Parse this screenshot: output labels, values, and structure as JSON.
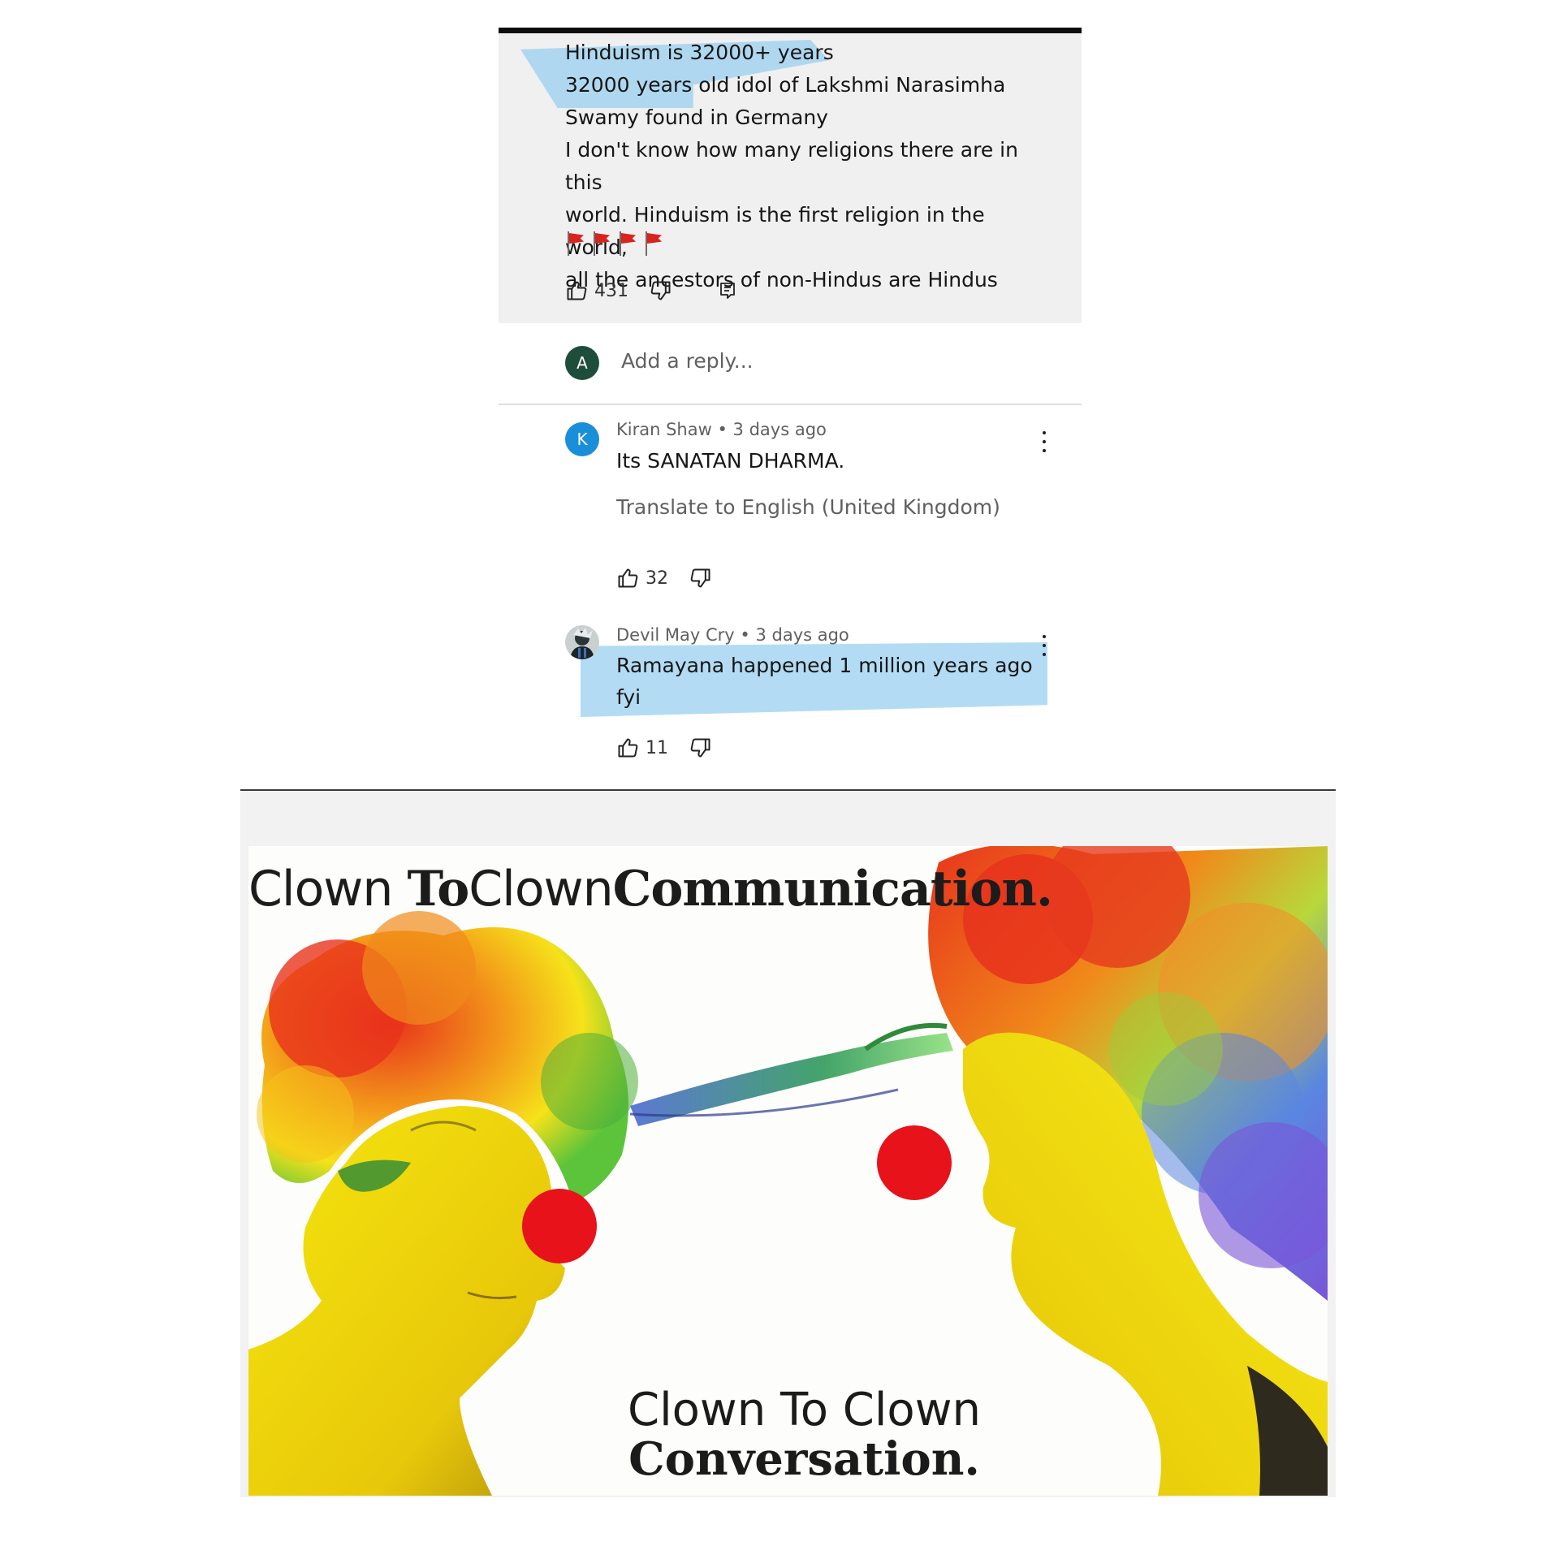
{
  "comment": {
    "lines": [
      "Hinduism is 32000+ years",
      "32000 years old idol of Lakshmi Narasimha",
      "Swamy found in Germany",
      "I don't know how many religions there are in this",
      "world. Hinduism is the first religion in the world,",
      "all the ancestors of non-Hindus are Hindus"
    ],
    "flag_count": 4,
    "likes": "431",
    "icons": [
      "flag-icon",
      "thumbs-up-icon",
      "thumbs-down-icon",
      "reply-icon"
    ]
  },
  "reply_box": {
    "avatar_letter": "A",
    "avatar_color": "#1e4d3c",
    "placeholder": "Add a reply..."
  },
  "replies": [
    {
      "avatar_letter": "K",
      "avatar_color": "#1a8fd9",
      "author": "Kiran Shaw",
      "age": "3 days ago",
      "separator": "•",
      "body": "Its SANATAN DHARMA.",
      "translate": "Translate to English (United Kingdom)",
      "likes": "32"
    },
    {
      "author": "Devil May Cry",
      "age": "3 days ago",
      "separator": "•",
      "body_lines": [
        "Ramayana happened 1 million years ago",
        "fyi"
      ],
      "likes": "11"
    }
  ],
  "highlight_color": "#96cef0",
  "meme": {
    "top_caption": {
      "part1": "Clown ",
      "part2": "To",
      "part3": "Clown",
      "part4": "Communication."
    },
    "bottom_caption": {
      "line1": "Clown To Clown",
      "line2": "Conversation."
    },
    "colors": {
      "skin": "#f3e20a",
      "nose": "#e8121a",
      "wig_red": "#e8331c",
      "wig_orange": "#f39a1a",
      "wig_green": "#5cc43a",
      "wig_blue": "#5a86e0",
      "wig_purple": "#7a55d8"
    }
  }
}
